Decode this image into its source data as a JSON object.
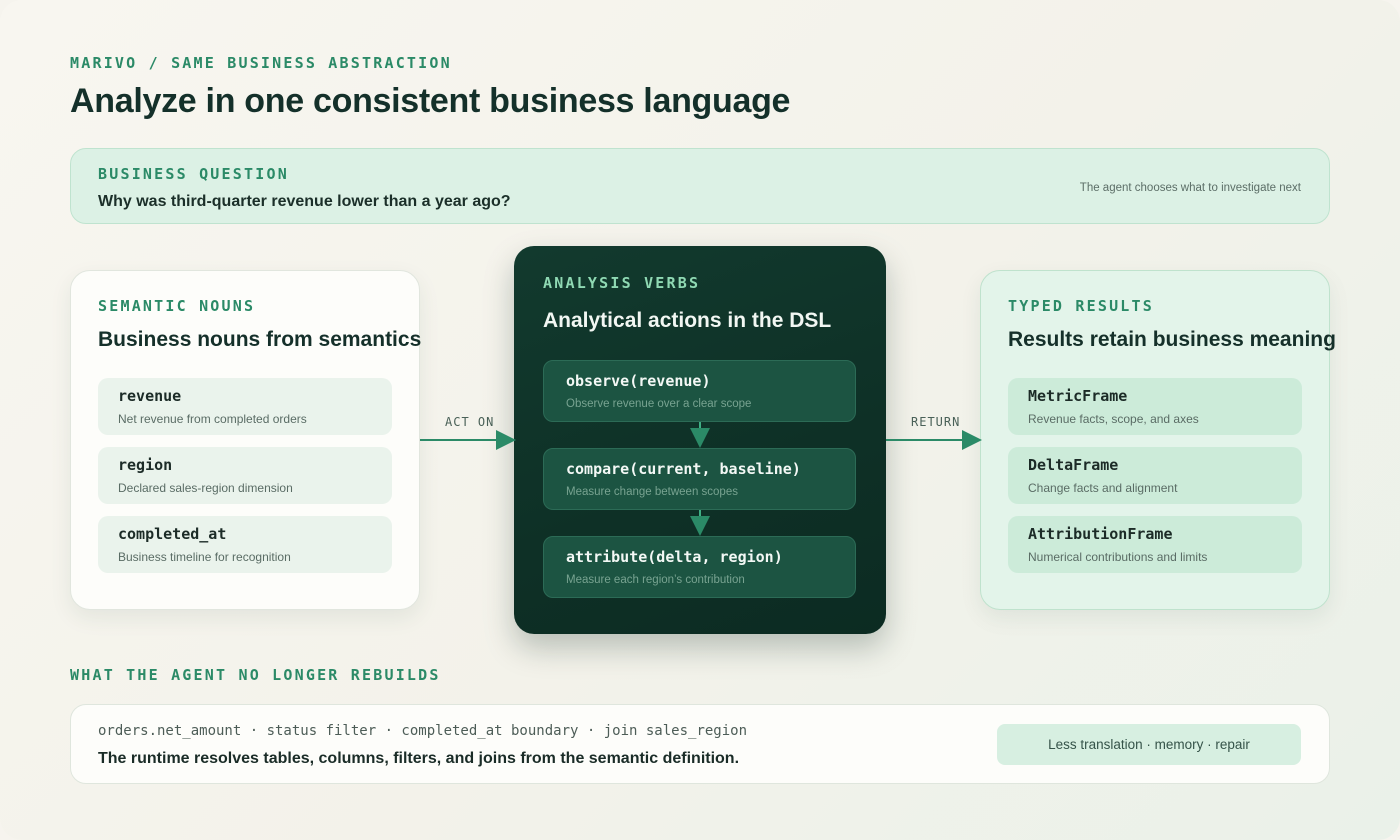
{
  "header": {
    "eyebrow": "MARIVO / SAME BUSINESS ABSTRACTION",
    "title": "Analyze in one consistent business language"
  },
  "question": {
    "eyebrow": "BUSINESS QUESTION",
    "text": "Why was third-quarter revenue lower than a year ago?",
    "note": "The agent chooses what to investigate next"
  },
  "nouns": {
    "eyebrow": "SEMANTIC NOUNS",
    "title": "Business nouns from semantics",
    "items": [
      {
        "name": "revenue",
        "desc": "Net revenue from completed orders"
      },
      {
        "name": "region",
        "desc": "Declared sales-region dimension"
      },
      {
        "name": "completed_at",
        "desc": "Business timeline for recognition"
      }
    ]
  },
  "verbs": {
    "eyebrow": "ANALYSIS VERBS",
    "title": "Analytical actions in the DSL",
    "items": [
      {
        "name": "observe(revenue)",
        "desc": "Observe revenue over a clear scope"
      },
      {
        "name": "compare(current, baseline)",
        "desc": "Measure change between scopes"
      },
      {
        "name": "attribute(delta, region)",
        "desc": "Measure each region’s contribution"
      }
    ]
  },
  "results": {
    "eyebrow": "TYPED RESULTS",
    "title": "Results retain business meaning",
    "items": [
      {
        "name": "MetricFrame",
        "desc": "Revenue facts, scope, and axes"
      },
      {
        "name": "DeltaFrame",
        "desc": "Change facts and alignment"
      },
      {
        "name": "AttributionFrame",
        "desc": "Numerical contributions and limits"
      }
    ]
  },
  "connectors": {
    "act_on": "ACT ON",
    "return": "RETURN"
  },
  "rebuild": {
    "eyebrow": "WHAT THE AGENT NO LONGER REBUILDS",
    "code": "orders.net_amount · status filter · completed_at boundary · join sales_region",
    "text": "The runtime resolves tables, columns, filters, and joins from the semantic definition.",
    "pill": "Less translation · memory · repair"
  },
  "colors": {
    "accent": "#2b8a67",
    "dark_card": "#0e3026",
    "mint": "#dcf1e5"
  }
}
